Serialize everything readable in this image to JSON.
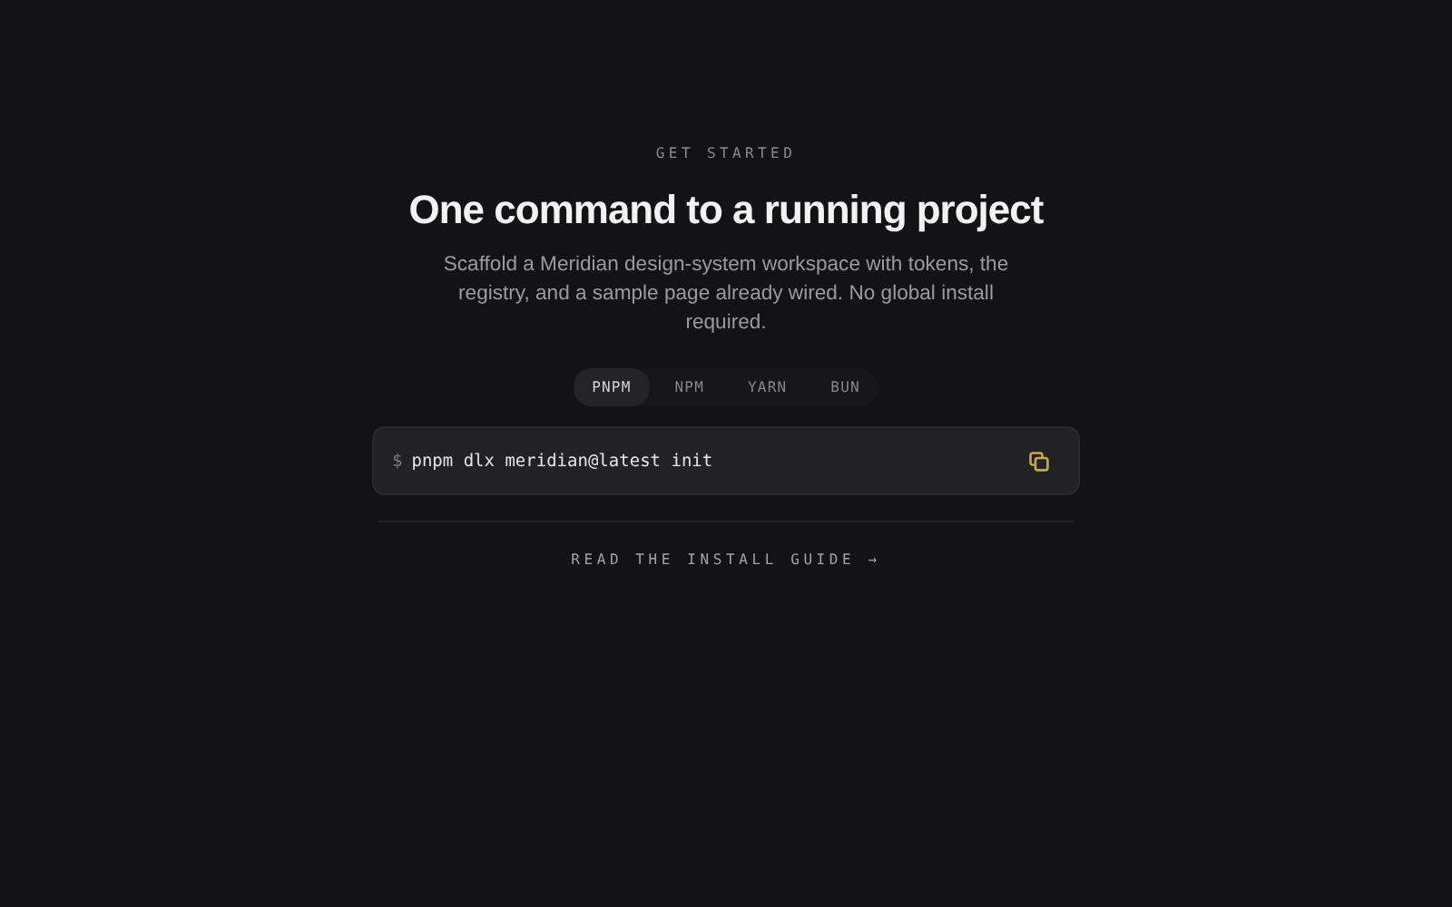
{
  "eyebrow": "GET STARTED",
  "title": "One command to a running project",
  "description": "Scaffold a Meridian design-system workspace with tokens, the registry, and a sample page already wired. No global install required.",
  "tabs": [
    {
      "label": "PNPM",
      "selected": true
    },
    {
      "label": "NPM",
      "selected": false
    },
    {
      "label": "YARN",
      "selected": false
    },
    {
      "label": "BUN",
      "selected": false
    }
  ],
  "command": {
    "prompt": "$",
    "text": "pnpm dlx meridian@latest init"
  },
  "link": "READ THE INSTALL GUIDE →"
}
